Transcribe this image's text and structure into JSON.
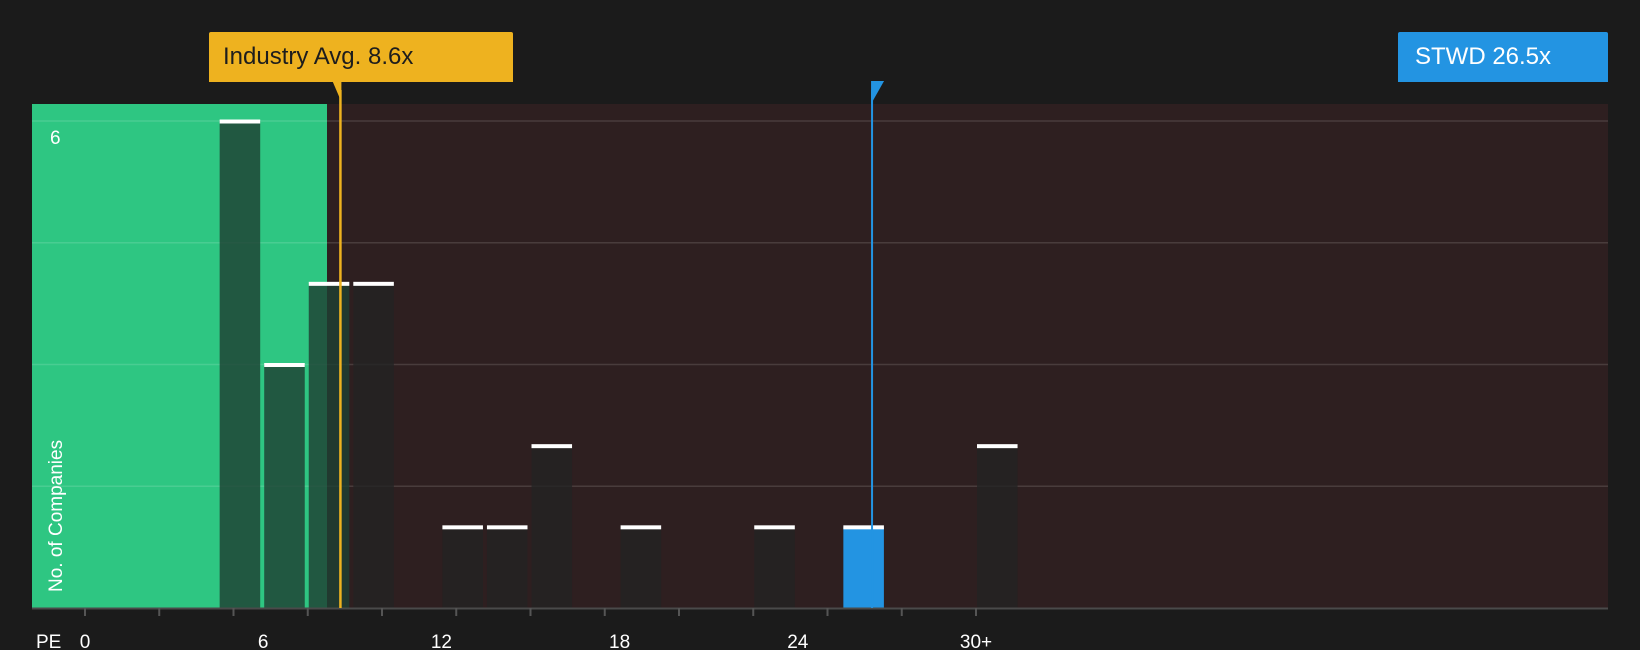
{
  "chart_data": {
    "type": "bar",
    "metric_label": "PE",
    "ylabel": "No. of Companies",
    "y_tick_label": "6",
    "ylim": [
      0,
      6
    ],
    "xlim": [
      0,
      31
    ],
    "x_tick_values": [
      0,
      6,
      12,
      18,
      24,
      30
    ],
    "x_tick_labels": [
      "0",
      "6",
      "12",
      "18",
      "24",
      "30+"
    ],
    "bins": [
      {
        "from": 4.5,
        "to": 6.0,
        "count": 6
      },
      {
        "from": 6.0,
        "to": 7.5,
        "count": 3
      },
      {
        "from": 7.5,
        "to": 9.0,
        "count": 4
      },
      {
        "from": 9.0,
        "to": 10.5,
        "count": 4
      },
      {
        "from": 12.0,
        "to": 13.5,
        "count": 1
      },
      {
        "from": 13.5,
        "to": 15.0,
        "count": 1
      },
      {
        "from": 15.0,
        "to": 16.5,
        "count": 2
      },
      {
        "from": 18.0,
        "to": 19.5,
        "count": 1
      },
      {
        "from": 22.5,
        "to": 24.0,
        "count": 1
      },
      {
        "from": 25.5,
        "to": 27.0,
        "count": 1,
        "highlight": true
      },
      {
        "from": 30.0,
        "to": 31.5,
        "count": 2
      }
    ],
    "industry_avg": {
      "value": 8.6,
      "label": "Industry Avg. 8.6x"
    },
    "company": {
      "ticker": "STWD",
      "value": 26.5,
      "label": "STWD 26.5x"
    },
    "fair_zone_end": 8.15,
    "colors": {
      "background": "#1b1b1b",
      "fair_zone": "#2ec682",
      "expensive_zone": "#2e1f20",
      "bar": "#232323",
      "bar_on_green": "#1e3f33",
      "highlight_bar": "#2394e2",
      "industry_line": "#eeb21f",
      "company_line": "#2394e2",
      "bar_cap": "#ffffff"
    }
  }
}
